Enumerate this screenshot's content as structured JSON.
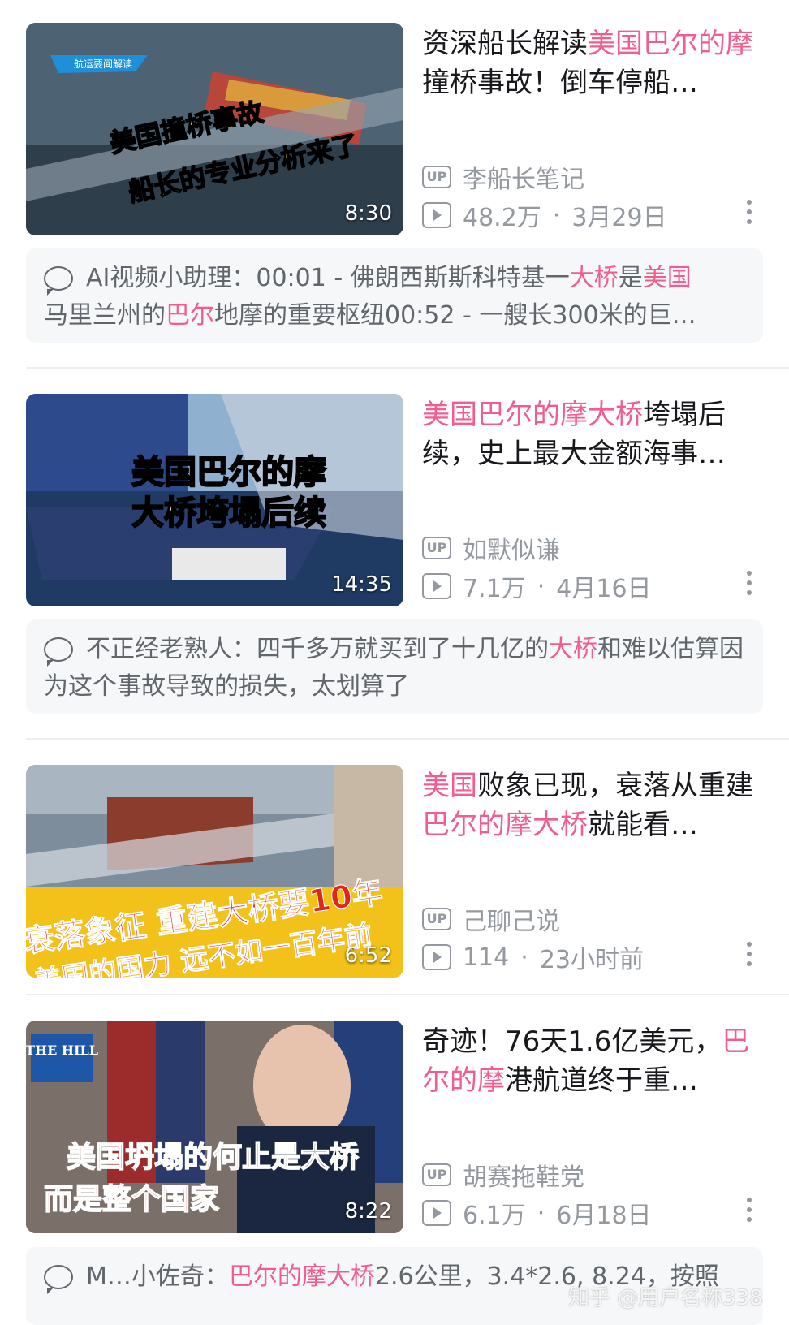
{
  "videos": [
    {
      "thumb_overlay": [
        "美国撞桥事故",
        "船长的专业分析来了"
      ],
      "thumb_badge": "航运要闻解读",
      "duration": "8:30",
      "title_parts": [
        {
          "text": "资深船长解读",
          "hl": false
        },
        {
          "text": "美国巴尔的摩",
          "hl": true
        },
        {
          "text": "撞桥事故！倒车停船…",
          "hl": false
        }
      ],
      "uploader": "李船长笔记",
      "views": "48.2万",
      "date": "3月29日",
      "comment_parts": [
        {
          "text": "AI视频小助理：00:01 - 佛朗西斯斯科特基一",
          "hl": false
        },
        {
          "text": "大桥",
          "hl": true
        },
        {
          "text": "是",
          "hl": false
        },
        {
          "text": "美国",
          "hl": true
        },
        {
          "text": "马里兰州的",
          "hl": false
        },
        {
          "text": "巴尔",
          "hl": true
        },
        {
          "text": "地摩的重要枢纽00:52 - 一艘长300米的巨…",
          "hl": false
        }
      ]
    },
    {
      "thumb_overlay": [
        "美国巴尔的摩",
        "大桥垮塌后续"
      ],
      "duration": "14:35",
      "title_parts": [
        {
          "text": "美国巴尔的摩大桥",
          "hl": true
        },
        {
          "text": "垮塌后续，史上最大金额海事…",
          "hl": false
        }
      ],
      "uploader": "如默似谦",
      "views": "7.1万",
      "date": "4月16日",
      "comment_parts": [
        {
          "text": "不正经老熟人：四千多万就买到了十几亿的",
          "hl": false
        },
        {
          "text": "大桥",
          "hl": true
        },
        {
          "text": "和难以估算因为这个事故导致的损失，太划算了",
          "hl": false
        }
      ]
    },
    {
      "thumb_overlay": [
        "衰落象征 重建大桥要10年",
        "美国的国力 远不如一百年前"
      ],
      "duration": "6:52",
      "title_parts": [
        {
          "text": "美国",
          "hl": true
        },
        {
          "text": "败象已现，衰落从重建",
          "hl": false
        },
        {
          "text": "巴尔的摩大桥",
          "hl": true
        },
        {
          "text": "就能看…",
          "hl": false
        }
      ],
      "uploader": "己聊己说",
      "views": "114",
      "date": "23小时前"
    },
    {
      "thumb_overlay": [
        "美国坍塌的何止是大桥",
        "而是整个国家"
      ],
      "thumb_badge": "THE HILL",
      "duration": "8:22",
      "title_parts": [
        {
          "text": "奇迹！76天1.6亿美元，",
          "hl": false
        },
        {
          "text": "巴尔的摩",
          "hl": true
        },
        {
          "text": "港航道终于重…",
          "hl": false
        }
      ],
      "uploader": "胡赛拖鞋党",
      "views": "6.1万",
      "date": "6月18日",
      "comment_parts": [
        {
          "text": "M…小佐奇：",
          "hl": false
        },
        {
          "text": "巴尔的摩大桥",
          "hl": true
        },
        {
          "text": "2.6公里，3.4*2.6, 8.24，按照",
          "hl": false
        }
      ]
    }
  ],
  "watermark": "知乎 @用户名称338",
  "labels": {
    "up": "UP",
    "sep": "·"
  },
  "colors": {
    "highlight": "#f25d8e",
    "meta": "#9499a0",
    "comment_bg": "#f6f7f8"
  }
}
